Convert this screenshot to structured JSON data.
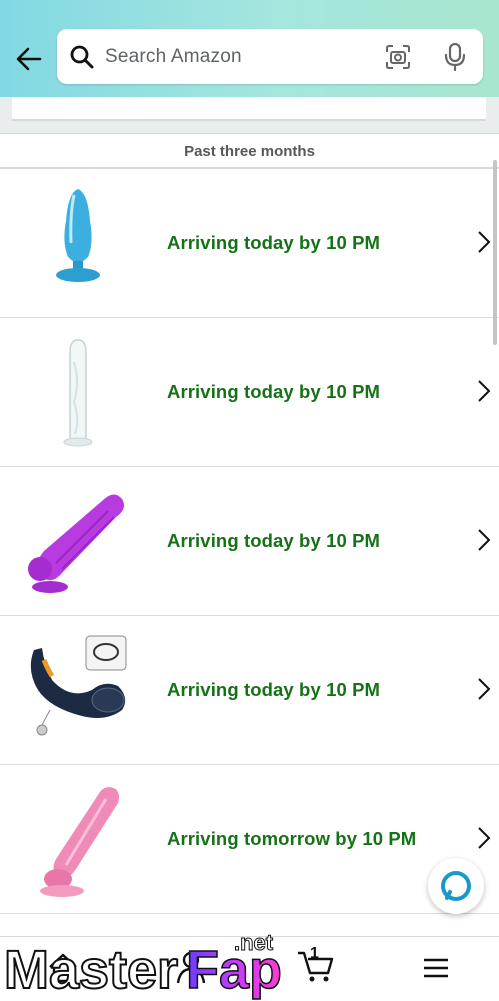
{
  "search": {
    "placeholder": "Search Amazon"
  },
  "section": {
    "label": "Past three months"
  },
  "orders": [
    {
      "status": "Arriving today by 10 PM",
      "product_color": "#3bb0e0"
    },
    {
      "status": "Arriving today by 10 PM",
      "product_color": "#e8eef0"
    },
    {
      "status": "Arriving today by 10 PM",
      "product_color": "#b83be0"
    },
    {
      "status": "Arriving today by 10 PM",
      "product_color": "#1c2a44"
    },
    {
      "status": "Arriving tomorrow by 10 PM",
      "product_color": "#f08bb8"
    }
  ],
  "cart": {
    "count": "1"
  },
  "watermark": {
    "text": "MasterFap",
    "suffix": ".net"
  },
  "colors": {
    "status_green": "#157216",
    "header_start": "#82d8e3",
    "header_end": "#a8e6cf",
    "alexa": "#1a98c9"
  }
}
